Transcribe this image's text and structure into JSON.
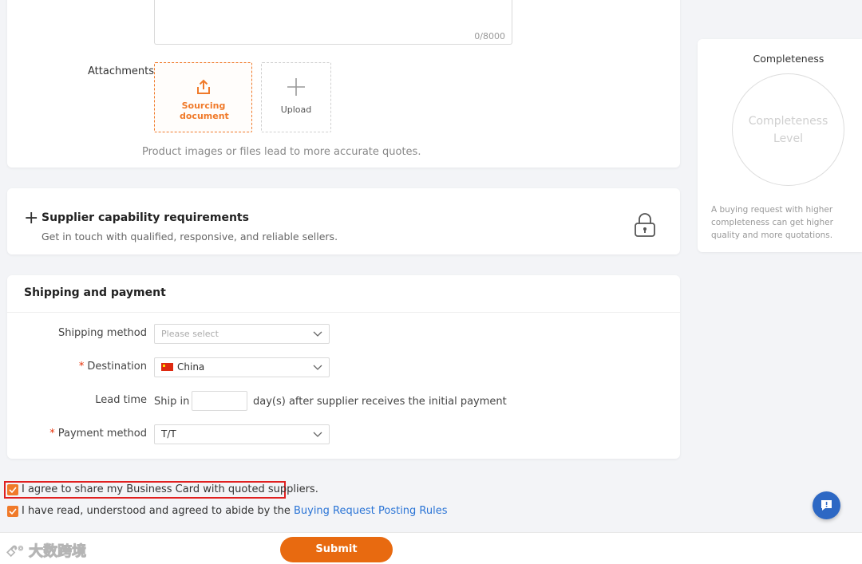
{
  "details": {
    "char_count": "0/8000",
    "attachments_label": "Attachments",
    "sourcing_document_label": "Sourcing document",
    "upload_label": "Upload",
    "hint": "Product images or files lead to more accurate quotes."
  },
  "supplier": {
    "title": "Supplier capability requirements",
    "subtitle": "Get in touch with qualified, responsive, and reliable sellers."
  },
  "shipping": {
    "title": "Shipping and payment",
    "shipping_method_label": "Shipping method",
    "shipping_method_placeholder": "Please select",
    "destination_label": "Destination",
    "destination_value": "China",
    "lead_time_label": "Lead time",
    "ship_in_label": "Ship in",
    "lead_time_value": "",
    "lead_time_suffix": "day(s) after supplier receives the initial payment",
    "payment_method_label": "Payment method",
    "payment_method_value": "T/T",
    "required_mark": "*"
  },
  "agreements": {
    "share_card_text": "I agree to share my Business Card with quoted suppliers.",
    "share_card_checked": true,
    "rules_text": "I have read, understood and agreed to abide by the",
    "rules_link": "Buying Request Posting Rules",
    "rules_checked": true
  },
  "completeness": {
    "title": "Completeness",
    "circle_text_1": "Completeness",
    "circle_text_2": "Level",
    "description": "A buying request with higher completeness can get higher quality and more quotations."
  },
  "footer": {
    "submit_label": "Submit",
    "watermark": "大数跨境"
  },
  "colors": {
    "accent": "#e86a10",
    "checkbox": "#f07a2a",
    "link": "#2a74d6",
    "required": "#e62e04",
    "feedback_button": "#2d68c4"
  },
  "icons": {
    "sourcing": "share-upload-icon",
    "upload": "plus-icon",
    "supplier_expand": "plus-icon",
    "lock": "lock-icon",
    "chevron": "chevron-down-icon",
    "feedback": "chat-bubble-icon"
  }
}
